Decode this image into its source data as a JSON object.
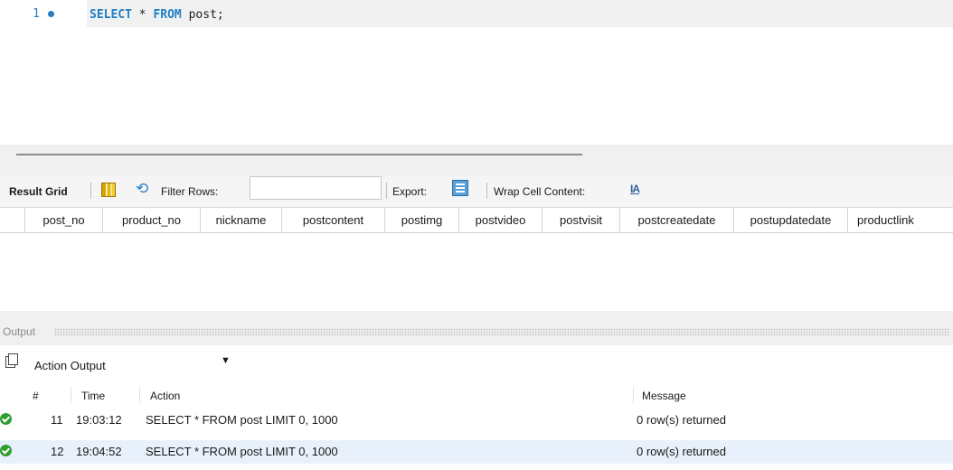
{
  "editor": {
    "line_number": "1",
    "sql_keyword_1": "SELECT",
    "sql_star": " * ",
    "sql_keyword_2": "FROM",
    "sql_rest": " post;"
  },
  "result_toolbar": {
    "result_grid_label": "Result Grid",
    "filter_rows_label": "Filter Rows:",
    "filter_value": "",
    "export_label": "Export:",
    "wrap_label": "Wrap Cell Content:",
    "wrap_icon_text": "IA"
  },
  "grid": {
    "columns": [
      "post_no",
      "product_no",
      "nickname",
      "postcontent",
      "postimg",
      "postvideo",
      "postvisit",
      "postcreatedate",
      "postupdatedate",
      "productlink"
    ]
  },
  "output": {
    "title": "Output",
    "selector_value": "Action Output",
    "headers": {
      "num": "#",
      "time": "Time",
      "action": "Action",
      "message": "Message"
    },
    "rows": [
      {
        "num": "11",
        "time": "19:03:12",
        "action": "SELECT * FROM post LIMIT 0, 1000",
        "message": "0 row(s) returned"
      },
      {
        "num": "12",
        "time": "19:04:52",
        "action": "SELECT * FROM post LIMIT 0, 1000",
        "message": "0 row(s) returned"
      }
    ]
  },
  "colors": {
    "accent": "#1f7fc4",
    "status_ok": "#2e9e2e",
    "row_highlight": "#e8f1fb"
  },
  "icons": [
    "statement-dot-icon",
    "grid-icon",
    "refresh-icon",
    "export-icon",
    "wrap-icon",
    "copy-icon",
    "chevron-down-icon",
    "success-icon"
  ]
}
